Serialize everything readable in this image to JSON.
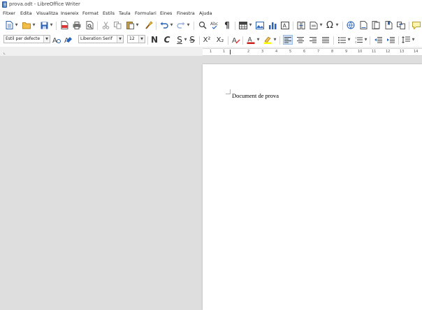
{
  "window": {
    "title": "prova.odt - LibreOffice Writer"
  },
  "menu": [
    "Fitxer",
    "Edita",
    "Visualitza",
    "Insereix",
    "Format",
    "Estils",
    "Taula",
    "Formulari",
    "Eines",
    "Finestra",
    "Ajuda"
  ],
  "format_bar": {
    "paragraph_style": "Estil per defecte",
    "font_name": "Liberation Serif",
    "font_size": "12",
    "bold_label": "N",
    "italic_label": "C",
    "underline_label": "S",
    "strike_label": "S",
    "superscript_label": "X²",
    "subscript_label": "X₂"
  },
  "ruler": {
    "marks": [
      "1",
      "1",
      "2",
      "3",
      "4",
      "5",
      "6",
      "7",
      "8",
      "9",
      "10",
      "11",
      "12",
      "13",
      "14"
    ]
  },
  "document": {
    "text": "Document de prova"
  },
  "colors": {
    "accent": "#2a63b7",
    "highlight_active": "#cfe0f5",
    "workspace": "#dedede"
  }
}
